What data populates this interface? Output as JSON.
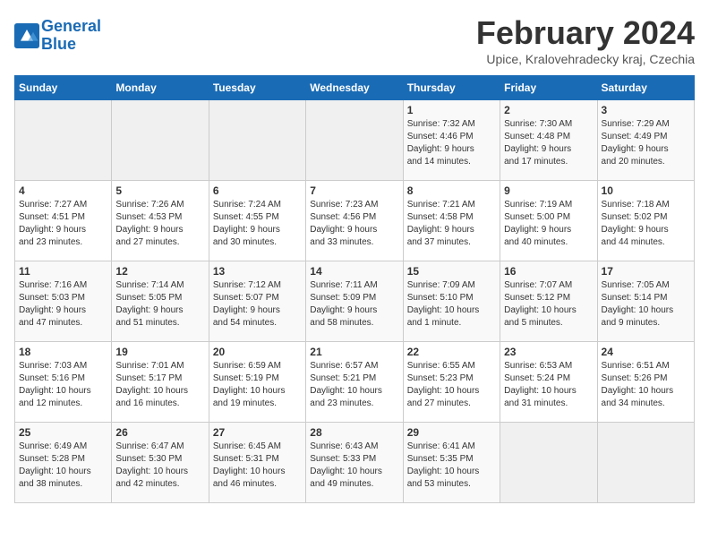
{
  "header": {
    "logo_line1": "General",
    "logo_line2": "Blue",
    "month_title": "February 2024",
    "subtitle": "Upice, Kralovehradecky kraj, Czechia"
  },
  "weekdays": [
    "Sunday",
    "Monday",
    "Tuesday",
    "Wednesday",
    "Thursday",
    "Friday",
    "Saturday"
  ],
  "weeks": [
    [
      {
        "day": "",
        "info": ""
      },
      {
        "day": "",
        "info": ""
      },
      {
        "day": "",
        "info": ""
      },
      {
        "day": "",
        "info": ""
      },
      {
        "day": "1",
        "info": "Sunrise: 7:32 AM\nSunset: 4:46 PM\nDaylight: 9 hours\nand 14 minutes."
      },
      {
        "day": "2",
        "info": "Sunrise: 7:30 AM\nSunset: 4:48 PM\nDaylight: 9 hours\nand 17 minutes."
      },
      {
        "day": "3",
        "info": "Sunrise: 7:29 AM\nSunset: 4:49 PM\nDaylight: 9 hours\nand 20 minutes."
      }
    ],
    [
      {
        "day": "4",
        "info": "Sunrise: 7:27 AM\nSunset: 4:51 PM\nDaylight: 9 hours\nand 23 minutes."
      },
      {
        "day": "5",
        "info": "Sunrise: 7:26 AM\nSunset: 4:53 PM\nDaylight: 9 hours\nand 27 minutes."
      },
      {
        "day": "6",
        "info": "Sunrise: 7:24 AM\nSunset: 4:55 PM\nDaylight: 9 hours\nand 30 minutes."
      },
      {
        "day": "7",
        "info": "Sunrise: 7:23 AM\nSunset: 4:56 PM\nDaylight: 9 hours\nand 33 minutes."
      },
      {
        "day": "8",
        "info": "Sunrise: 7:21 AM\nSunset: 4:58 PM\nDaylight: 9 hours\nand 37 minutes."
      },
      {
        "day": "9",
        "info": "Sunrise: 7:19 AM\nSunset: 5:00 PM\nDaylight: 9 hours\nand 40 minutes."
      },
      {
        "day": "10",
        "info": "Sunrise: 7:18 AM\nSunset: 5:02 PM\nDaylight: 9 hours\nand 44 minutes."
      }
    ],
    [
      {
        "day": "11",
        "info": "Sunrise: 7:16 AM\nSunset: 5:03 PM\nDaylight: 9 hours\nand 47 minutes."
      },
      {
        "day": "12",
        "info": "Sunrise: 7:14 AM\nSunset: 5:05 PM\nDaylight: 9 hours\nand 51 minutes."
      },
      {
        "day": "13",
        "info": "Sunrise: 7:12 AM\nSunset: 5:07 PM\nDaylight: 9 hours\nand 54 minutes."
      },
      {
        "day": "14",
        "info": "Sunrise: 7:11 AM\nSunset: 5:09 PM\nDaylight: 9 hours\nand 58 minutes."
      },
      {
        "day": "15",
        "info": "Sunrise: 7:09 AM\nSunset: 5:10 PM\nDaylight: 10 hours\nand 1 minute."
      },
      {
        "day": "16",
        "info": "Sunrise: 7:07 AM\nSunset: 5:12 PM\nDaylight: 10 hours\nand 5 minutes."
      },
      {
        "day": "17",
        "info": "Sunrise: 7:05 AM\nSunset: 5:14 PM\nDaylight: 10 hours\nand 9 minutes."
      }
    ],
    [
      {
        "day": "18",
        "info": "Sunrise: 7:03 AM\nSunset: 5:16 PM\nDaylight: 10 hours\nand 12 minutes."
      },
      {
        "day": "19",
        "info": "Sunrise: 7:01 AM\nSunset: 5:17 PM\nDaylight: 10 hours\nand 16 minutes."
      },
      {
        "day": "20",
        "info": "Sunrise: 6:59 AM\nSunset: 5:19 PM\nDaylight: 10 hours\nand 19 minutes."
      },
      {
        "day": "21",
        "info": "Sunrise: 6:57 AM\nSunset: 5:21 PM\nDaylight: 10 hours\nand 23 minutes."
      },
      {
        "day": "22",
        "info": "Sunrise: 6:55 AM\nSunset: 5:23 PM\nDaylight: 10 hours\nand 27 minutes."
      },
      {
        "day": "23",
        "info": "Sunrise: 6:53 AM\nSunset: 5:24 PM\nDaylight: 10 hours\nand 31 minutes."
      },
      {
        "day": "24",
        "info": "Sunrise: 6:51 AM\nSunset: 5:26 PM\nDaylight: 10 hours\nand 34 minutes."
      }
    ],
    [
      {
        "day": "25",
        "info": "Sunrise: 6:49 AM\nSunset: 5:28 PM\nDaylight: 10 hours\nand 38 minutes."
      },
      {
        "day": "26",
        "info": "Sunrise: 6:47 AM\nSunset: 5:30 PM\nDaylight: 10 hours\nand 42 minutes."
      },
      {
        "day": "27",
        "info": "Sunrise: 6:45 AM\nSunset: 5:31 PM\nDaylight: 10 hours\nand 46 minutes."
      },
      {
        "day": "28",
        "info": "Sunrise: 6:43 AM\nSunset: 5:33 PM\nDaylight: 10 hours\nand 49 minutes."
      },
      {
        "day": "29",
        "info": "Sunrise: 6:41 AM\nSunset: 5:35 PM\nDaylight: 10 hours\nand 53 minutes."
      },
      {
        "day": "",
        "info": ""
      },
      {
        "day": "",
        "info": ""
      }
    ]
  ]
}
